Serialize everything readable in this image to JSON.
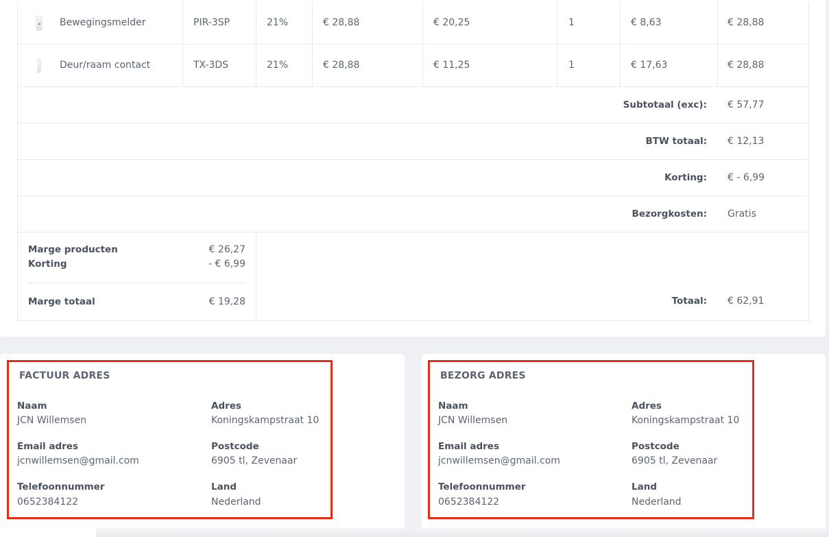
{
  "products": [
    {
      "name": "Bewegingsmelder",
      "code": "PIR-3SP",
      "vat": "21%",
      "price": "€ 28,88",
      "cost": "€ 20,25",
      "qty": "1",
      "margin": "€ 8,63",
      "total": "€ 28,88",
      "thumb_icon": "motion-sensor-thumbnail"
    },
    {
      "name": "Deur/raam contact",
      "code": "TX-3DS",
      "vat": "21%",
      "price": "€ 28,88",
      "cost": "€ 11,25",
      "qty": "1",
      "margin": "€ 17,63",
      "total": "€ 28,88",
      "thumb_icon": "door-window-contact-thumbnail"
    }
  ],
  "summary": {
    "subtotal_label": "Subtotaal (exc):",
    "subtotal_value": "€ 57,77",
    "btw_label": "BTW totaal:",
    "btw_value": "€ 12,13",
    "korting_label": "Korting:",
    "korting_value": "€ - 6,99",
    "shipping_label": "Bezorgkosten:",
    "shipping_value": "Gratis",
    "total_label": "Totaal:",
    "total_value": "€ 62,91"
  },
  "marge": {
    "products_label": "Marge producten",
    "products_value": "€ 26,27",
    "korting_label": "Korting",
    "korting_value": "- € 6,99",
    "total_label": "Marge totaal",
    "total_value": "€ 19,28"
  },
  "factuur": {
    "title": "FACTUUR ADRES",
    "naam_label": "Naam",
    "naam": "JCN Willemsen",
    "adres_label": "Adres",
    "adres": "Koningskampstraat 10",
    "email_label": "Email adres",
    "email": "jcnwillemsen@gmail.com",
    "postcode_label": "Postcode",
    "postcode": "6905 tl, Zevenaar",
    "tel_label": "Telefoonnummer",
    "tel": "0652384122",
    "land_label": "Land",
    "land": "Nederland"
  },
  "bezorg": {
    "title": "BEZORG ADRES",
    "naam_label": "Naam",
    "naam": "JCN Willemsen",
    "adres_label": "Adres",
    "adres": "Koningskampstraat 10",
    "email_label": "Email adres",
    "email": "jcnwillemsen@gmail.com",
    "postcode_label": "Postcode",
    "postcode": "6905 tl, Zevenaar",
    "tel_label": "Telefoonnummer",
    "tel": "0652384122",
    "land_label": "Land",
    "land": "Nederland"
  },
  "colors": {
    "highlight": "#e52e1a",
    "text": "#5b6470",
    "label": "#4a525d",
    "border": "#e6e8ec",
    "background": "#eff0f4"
  }
}
